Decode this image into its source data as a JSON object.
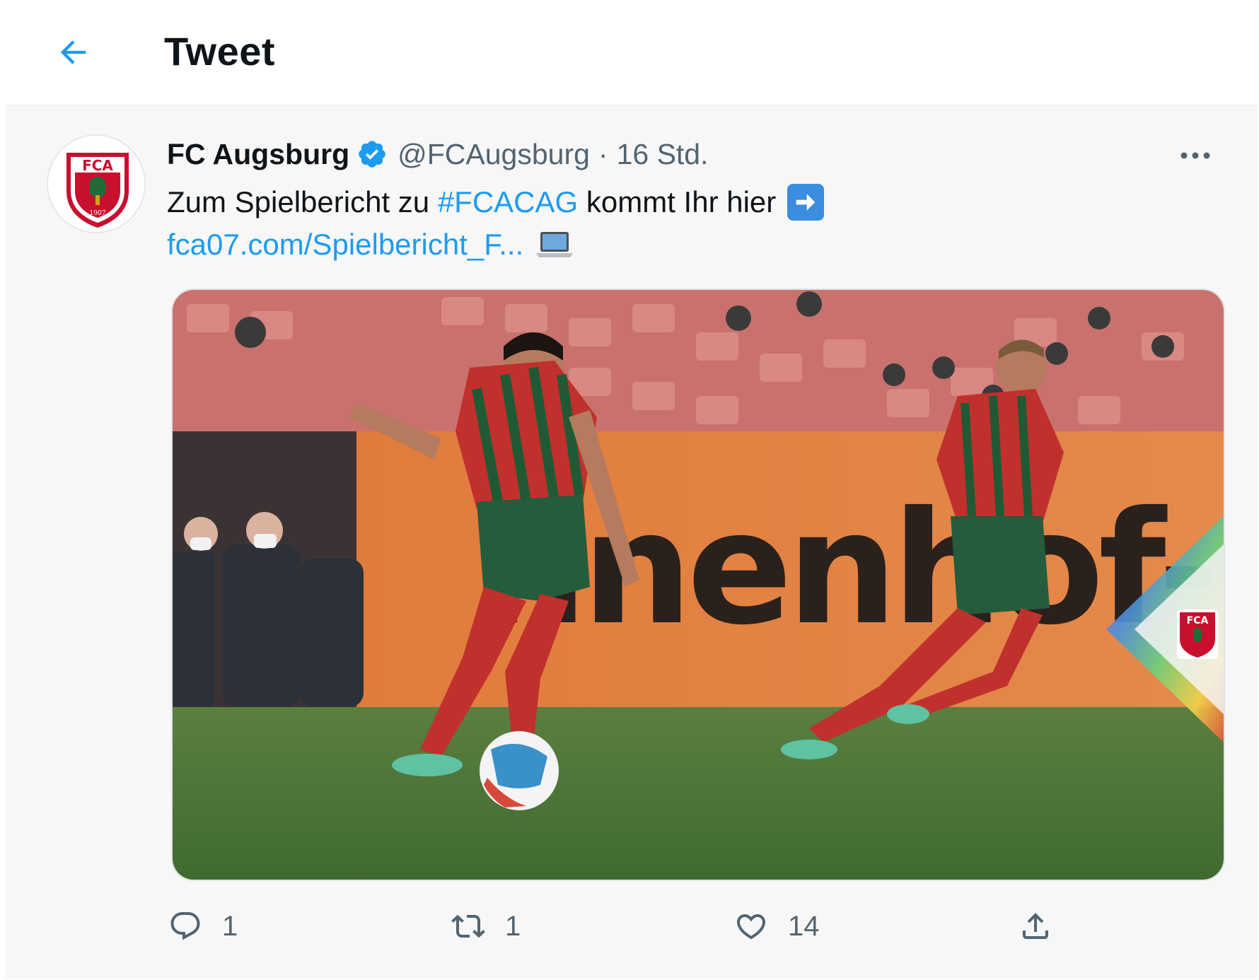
{
  "header": {
    "title": "Tweet",
    "back_icon": "arrow-left-icon",
    "accent": "#1d9bf0"
  },
  "tweet": {
    "author": {
      "display_name": "FC Augsburg",
      "handle": "@FCAugsburg",
      "verified": true,
      "avatar_icon": "fca-crest-logo",
      "avatar_text": "FCA",
      "avatar_year": "1907"
    },
    "separator": "·",
    "time": "16 Std.",
    "more_icon": "more-dots-icon",
    "text": {
      "before_hashtag": "Zum Spielbericht zu ",
      "hashtag": "#FCACAG",
      "after_hashtag": " kommt Ihr hier",
      "arrow_emoji": "right-arrow-emoji",
      "link": "fca07.com/Spielbericht_F...",
      "laptop_emoji": "laptop-emoji"
    },
    "media": {
      "description_icon": "match-photo",
      "board_text": "nnenhof-Boden",
      "badge_text": "FCA"
    },
    "actions": {
      "reply": {
        "icon": "reply-icon",
        "count": "1"
      },
      "retweet": {
        "icon": "retweet-icon",
        "count": "1"
      },
      "like": {
        "icon": "heart-icon",
        "count": "14"
      },
      "share": {
        "icon": "share-icon"
      }
    }
  }
}
